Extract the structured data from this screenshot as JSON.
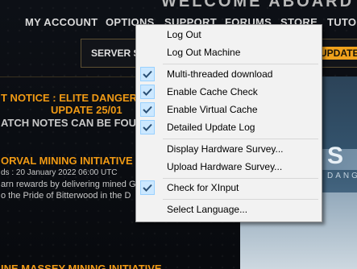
{
  "header": {
    "title": "WELCOME ABOARD"
  },
  "topnav": {
    "items": [
      "MY ACCOUNT",
      "OPTIONS",
      "SUPPORT",
      "FORUMS",
      "STORE",
      "TUTO"
    ]
  },
  "subbar": {
    "server_label": "SERVER S",
    "update_label": "UPDATE"
  },
  "news": {
    "notice_line1": "T NOTICE : ELITE DANGER",
    "notice_line2": "UPDATE 25/01",
    "notice_line3": "ATCH NOTES CAN BE FOUN",
    "article1_title": "ORVAL MINING INITIATIVE",
    "article1_date": "ds : 20 January 2022 06:00 UTC",
    "article1_body1": "arn rewards by delivering mined G",
    "article1_body2": "o the Pride of Bitterwood in the D",
    "article2_title": "INE MASSEY MINING INITIATIVE"
  },
  "banner": {
    "logo_text": "S",
    "logo_sub": "DANG"
  },
  "context_menu": {
    "items": [
      {
        "label": "Log Out",
        "checked": false
      },
      {
        "label": "Log Out Machine",
        "checked": false
      },
      {
        "label": "Multi-threaded download",
        "checked": true
      },
      {
        "label": "Enable Cache Check",
        "checked": true
      },
      {
        "label": "Enable Virtual Cache",
        "checked": true
      },
      {
        "label": "Detailed Update Log",
        "checked": true
      },
      {
        "label": "Display Hardware Survey...",
        "checked": false
      },
      {
        "label": "Upload Hardware Survey...",
        "checked": false
      },
      {
        "label": "Check for XInput",
        "checked": true
      },
      {
        "label": "Select Language...",
        "checked": false
      }
    ]
  },
  "colors": {
    "accent_orange": "#f09a14",
    "menu_check_bg": "#cce8ff",
    "menu_check_mark": "#2a4f74"
  }
}
